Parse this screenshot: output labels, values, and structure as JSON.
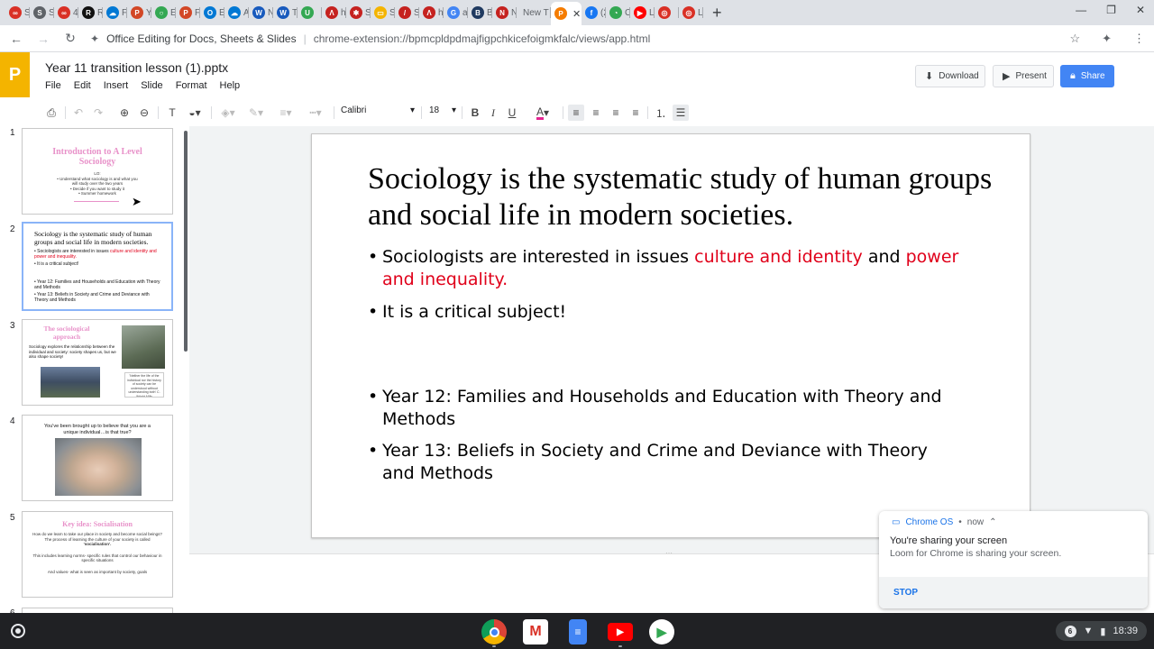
{
  "browser": {
    "tabs": [
      {
        "label": "Sc",
        "color": "#d93025",
        "glyph": "∞"
      },
      {
        "label": "S",
        "color": "#5f6368",
        "glyph": "S"
      },
      {
        "label": "4",
        "color": "#d93025",
        "glyph": "∞"
      },
      {
        "label": "R",
        "color": "#111111",
        "glyph": "R"
      },
      {
        "label": "Fi",
        "color": "#0078d4",
        "glyph": "☁"
      },
      {
        "label": "Yi",
        "color": "#d24726",
        "glyph": "P"
      },
      {
        "label": "E",
        "color": "#34a853",
        "glyph": "○"
      },
      {
        "label": "Fi",
        "color": "#d24726",
        "glyph": "P"
      },
      {
        "label": "E",
        "color": "#0078d4",
        "glyph": "O"
      },
      {
        "label": "A",
        "color": "#0078d4",
        "glyph": "☁"
      },
      {
        "label": "N",
        "color": "#185abd",
        "glyph": "W"
      },
      {
        "label": "Tr",
        "color": "#185abd",
        "glyph": "W"
      },
      {
        "label": "",
        "color": "#34a853",
        "glyph": "U"
      },
      {
        "label": "h",
        "color": "#c5221f",
        "glyph": "Λ"
      },
      {
        "label": "S",
        "color": "#c5221f",
        "glyph": "✱"
      },
      {
        "label": "S",
        "color": "#f4b400",
        "glyph": "▭"
      },
      {
        "label": "S",
        "color": "#c5221f",
        "glyph": "/"
      },
      {
        "label": "h",
        "color": "#c5221f",
        "glyph": "Λ"
      },
      {
        "label": "a",
        "color": "#4285f4",
        "glyph": "G"
      },
      {
        "label": "B",
        "color": "#1f3a60",
        "glyph": "B"
      },
      {
        "label": "N",
        "color": "#c5221f",
        "glyph": "N"
      },
      {
        "label": "New T",
        "color": "#dee1e6",
        "glyph": ""
      },
      {
        "label": "",
        "color": "#f57c00",
        "glyph": "P",
        "active": true
      },
      {
        "label": "(2",
        "color": "#1877f2",
        "glyph": "f"
      },
      {
        "label": "C",
        "color": "#34a853",
        "glyph": "◔"
      },
      {
        "label": "Lo",
        "color": "#ff0000",
        "glyph": "▶"
      },
      {
        "label": "",
        "color": "#d93025",
        "glyph": "◎"
      },
      {
        "label": "Lo",
        "color": "#d93025",
        "glyph": "◎"
      }
    ],
    "new_tab": "+",
    "site_name": "Office Editing for Docs, Sheets & Slides",
    "url": "chrome-extension://bpmcpldpdmajfigpchkicefoigmkfalc/views/app.html"
  },
  "app": {
    "logo_letter": "P",
    "doc_title": "Year 11 transition lesson (1).pptx",
    "menu": [
      "File",
      "Edit",
      "Insert",
      "Slide",
      "Format",
      "Help"
    ],
    "download_label": "Download",
    "present_label": "Present",
    "share_label": "Share"
  },
  "toolbar": {
    "font_name": "Calibri",
    "font_size": "18"
  },
  "slide": {
    "title": "Sociology is the systematic study of human groups and social life in modern societies.",
    "bullet1_prefix": "Sociologists are interested in issues ",
    "bullet1_red1": "culture and identity",
    "bullet1_mid": " and ",
    "bullet1_red2": "power and inequality.",
    "bullet2": "It is a critical subject!",
    "bullet3": "Year 12: Families and Households and Education with Theory and Methods",
    "bullet4": "Year 13: Beliefs in Society and Crime and Deviance with Theory and Methods"
  },
  "thumbnails": {
    "numbers": [
      "1",
      "2",
      "3",
      "4",
      "5",
      "6"
    ],
    "t1_title": "Introduction to A Level Sociology",
    "t1_lines": [
      "LO:",
      "• Understand what sociology is and what you",
      "will study over the two years",
      "• Decide if you want to study it",
      "• Summer homework"
    ],
    "t2_title": "Sociology is the systematic study of human groups and social life in modern societies.",
    "t2_b1": "• Sociologists are interested in issues ",
    "t2_b1_red": "culture and identity and power and inequality.",
    "t2_b2": "• It is a critical subject!",
    "t2_b3": "• Year 12: Families and Households and Education with Theory and Methods",
    "t2_b4": "• Year 13: Beliefs in Society and Crime and Deviance with Theory and Methods",
    "t3_title": "The sociological approach",
    "t3_text": "Sociology explores the relationship between the individual and society: society shapes us, but we also shape society!",
    "t3_caption": "'Neither the life of the individual nor the history of society can be understood without understanding both' C. Wright Mills",
    "t4_text": "You've been brought up to believe that you are a unique individual…is that true?",
    "t5_title": "Key idea: Socialisation",
    "t5_line1": "How do we learn to take our place in society and become social beings?",
    "t5_line2": "The process of learning the culture of your society is called",
    "t5_term": "'socialisation'.",
    "t5_line3": "This includes learning norms- specific rules that control our behaviour in specific situations",
    "t5_line4": "And values- what is seen as important by society, goals"
  },
  "notification": {
    "app_name": "Chrome OS",
    "time": "now",
    "title": "You're sharing your screen",
    "body": "Loom for Chrome is sharing your screen.",
    "action": "STOP"
  },
  "shelf": {
    "notif_count": "6",
    "time": "18:39"
  }
}
